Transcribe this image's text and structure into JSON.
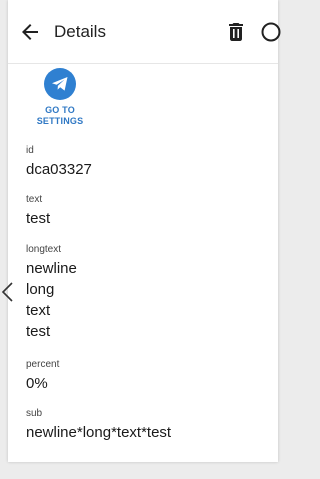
{
  "header": {
    "title": "Details",
    "back_icon": "arrow-back-icon",
    "delete_icon": "trash-icon",
    "more_icon": "more-icon"
  },
  "action": {
    "icon": "telegram-icon",
    "label_line1": "GO TO",
    "label_line2": "SETTINGS",
    "color": "#2f80d1"
  },
  "fields": {
    "id": {
      "label": "id",
      "value": "dca03327"
    },
    "text": {
      "label": "text",
      "value": "test"
    },
    "longtext": {
      "label": "longtext",
      "lines": [
        "newline",
        "long",
        "text",
        "test"
      ]
    },
    "percent": {
      "label": "percent",
      "value": "0%"
    },
    "sub": {
      "label": "sub",
      "value": "newline*long*text*test"
    }
  }
}
